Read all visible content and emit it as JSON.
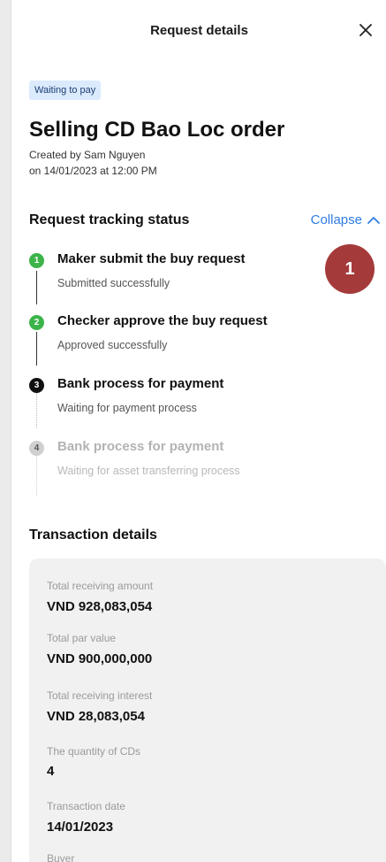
{
  "header": {
    "title": "Request details",
    "close_icon": "close-icon"
  },
  "status_badge": "Waiting to pay",
  "order": {
    "title": "Selling CD Bao Loc order",
    "created_by": "Created by Sam Nguyen",
    "created_on": "on 14/01/2023 at 12:00 PM"
  },
  "tracking": {
    "section_title": "Request tracking status",
    "collapse_label": "Collapse",
    "collapse_icon": "chevron-up-icon",
    "steps": [
      {
        "num": "1",
        "title": "Maker submit the buy request",
        "subtitle": "Submitted successfully",
        "state": "done",
        "color": "#3cb44a"
      },
      {
        "num": "2",
        "title": "Checker approve the buy request",
        "subtitle": "Approved successfully",
        "state": "done",
        "color": "#3cb44a"
      },
      {
        "num": "3",
        "title": "Bank process for payment",
        "subtitle": "Waiting for payment process",
        "state": "current",
        "color": "#111111"
      },
      {
        "num": "4",
        "title": "Bank process for payment",
        "subtitle": "Waiting for asset transferring process",
        "state": "pending",
        "color": "#c4c4c4"
      }
    ]
  },
  "annotation_marker": "1",
  "transaction": {
    "section_title": "Transaction details",
    "fields": [
      {
        "label": "Total receiving amount",
        "value": "VND 928,083,054"
      },
      {
        "label": "Total par value",
        "value": "VND 900,000,000"
      },
      {
        "label": "Total receiving interest",
        "value": "VND 28,083,054"
      },
      {
        "label": "The quantity of CDs",
        "value": "4"
      },
      {
        "label": "Transaction date",
        "value": "14/01/2023"
      },
      {
        "label": "Buyer",
        "value": ""
      }
    ]
  },
  "colors": {
    "accent": "#2f7de1",
    "badge_bg": "#dbeafd",
    "done": "#3cb44a",
    "marker": "#a53a3a"
  }
}
